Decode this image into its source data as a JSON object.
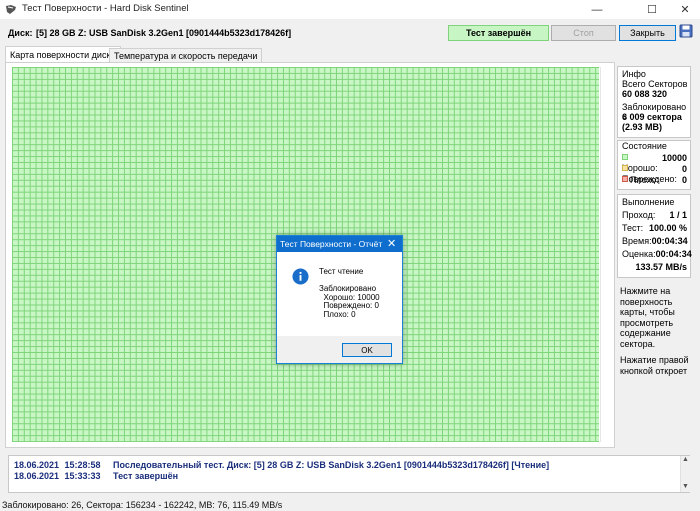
{
  "window": {
    "title": "Тест Поверхности - Hard Disk Sentinel",
    "icon": "hard-disk-sentinel-icon"
  },
  "toolbar": {
    "disk_label": "Диск:",
    "disk_value": "[5] 28 GB Z: USB SanDisk 3.2Gen1 [0901444b5323d178426f]",
    "status": "Тест завершён",
    "stop_label": "Стоп",
    "close_label": "Закрыть"
  },
  "tabs": [
    "Карта поверхности диска",
    "Температура и скорость передачи"
  ],
  "side": {
    "info": {
      "title": "Инфо",
      "total_label": "Всего Секторов",
      "total_value": "60 088 320",
      "blocked_label": "Заблокировано =",
      "blocked_sectors": "6 009 сектора",
      "blocked_size": "(2.93 MB)"
    },
    "state": {
      "title": "Состояние",
      "good_label": "Хорошо:",
      "good_value": "10000",
      "damaged_label": "Повреждено:",
      "damaged_value": "0",
      "bad_label": "Плохо:",
      "bad_value": "0"
    },
    "progress": {
      "title": "Выполнение",
      "pass_label": "Проход:",
      "pass_value": "1 / 1",
      "test_label": "Тест:",
      "test_value": "100.00 %",
      "time_label": "Время:",
      "time_value": "00:04:34",
      "estimate_label": "Оценка:",
      "estimate_value": "00:04:34",
      "speed_value": "133.57 MB/s"
    },
    "hint": "Нажмите на поверхность карты, чтобы просмотреть содержание сектора.",
    "hint2": "Нажатие правой кнопкой откроет"
  },
  "dialog": {
    "title": "Тест Поверхности - Отчёт",
    "message": "Тест чтение\n\nЗаблокировано\n  Хорошо: 10000\n  Повреждено: 0\n  Плохо: 0",
    "ok_label": "OK"
  },
  "log": [
    {
      "date": "18.06.2021",
      "time": "15:28:58",
      "text": "Последовательный тест. Диск: [5] 28 GB Z: USB SanDisk 3.2Gen1 [0901444b5323d178426f] [Чтение]"
    },
    {
      "date": "18.06.2021",
      "time": "15:33:33",
      "text": "Тест завершён"
    }
  ],
  "statusbar": "Заблокировано: 26, Сектора: 156234 - 162242, MB: 76, 115.49 MB/s",
  "colors": {
    "good": "#c8f7c5",
    "grid": "#7fd47a",
    "status_bg": "#c8f5c4",
    "accent": "#0f6ecd",
    "log_text": "#1a2e7c"
  }
}
